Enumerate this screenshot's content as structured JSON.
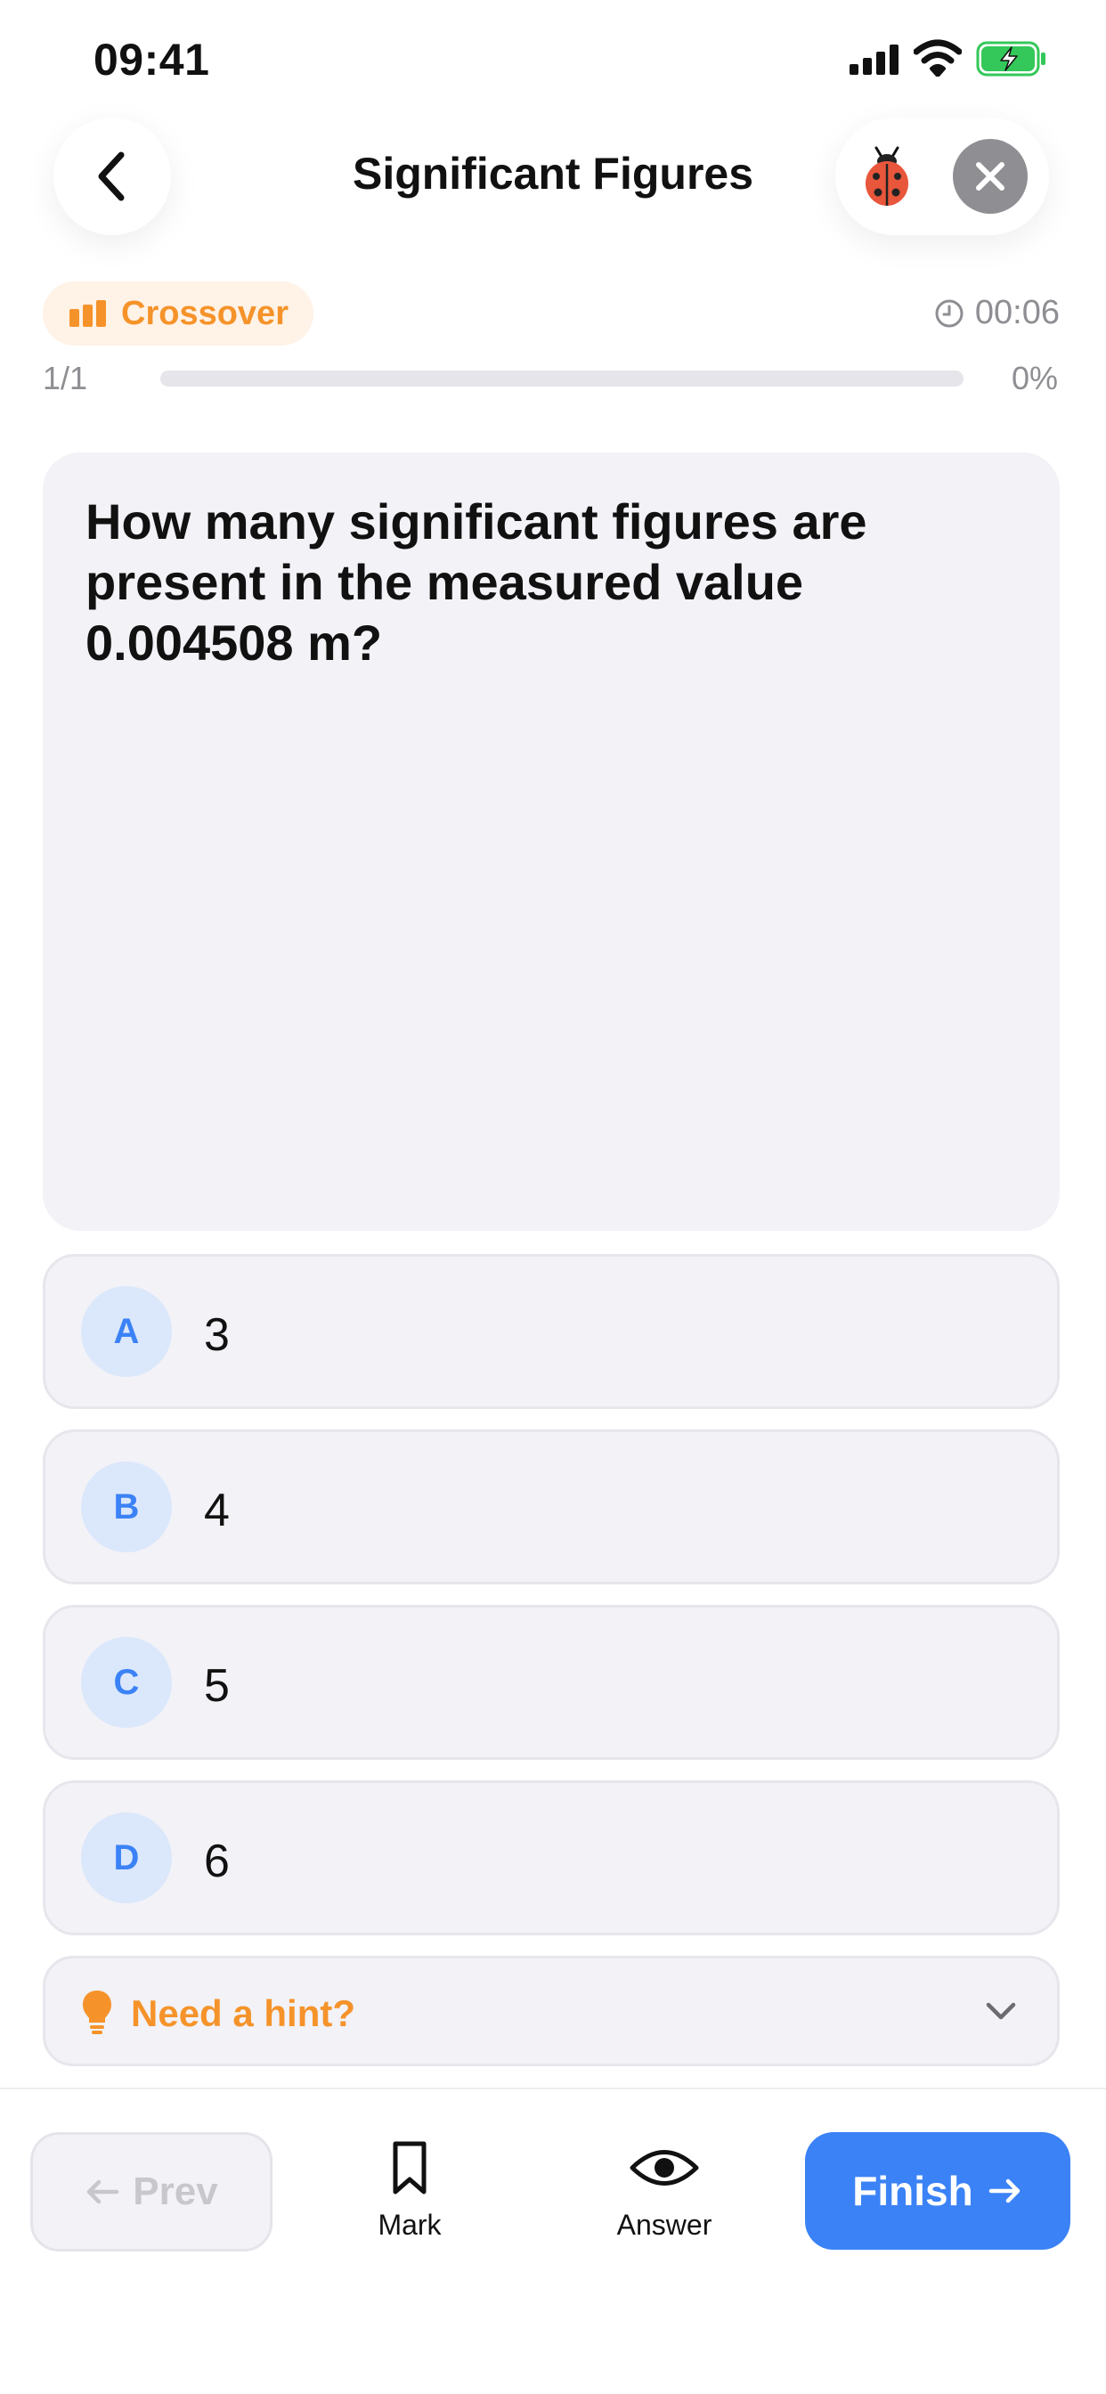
{
  "status_bar": {
    "time": "09:41"
  },
  "header": {
    "title": "Significant Figures"
  },
  "meta": {
    "level": "Crossover",
    "timer": "00:06",
    "progress_count": "1/1",
    "progress_percent": "0%",
    "progress_fraction": 0
  },
  "question": {
    "text": "How many significant figures are present in the measured value 0.004508 m?"
  },
  "options": [
    {
      "letter": "A",
      "text": "3"
    },
    {
      "letter": "B",
      "text": "4"
    },
    {
      "letter": "C",
      "text": "5"
    },
    {
      "letter": "D",
      "text": "6"
    }
  ],
  "hint": {
    "label": "Need a hint?"
  },
  "toolbar": {
    "prev_label": "Prev",
    "mark_label": "Mark",
    "answer_label": "Answer",
    "finish_label": "Finish"
  },
  "colors": {
    "accent": "#3b82f6",
    "orange": "#f5932a",
    "card_bg": "#f2f2f7",
    "option_letter_bg": "#dbe7fb",
    "battery_green": "#34c759"
  },
  "icons": [
    "signal-icon",
    "wifi-icon",
    "battery-icon",
    "chevron-left-icon",
    "ladybug-icon",
    "close-icon",
    "bars-icon",
    "clock-icon",
    "bulb-icon",
    "chevron-down-icon",
    "arrow-left-icon",
    "bookmark-icon",
    "eye-icon",
    "arrow-right-icon"
  ]
}
